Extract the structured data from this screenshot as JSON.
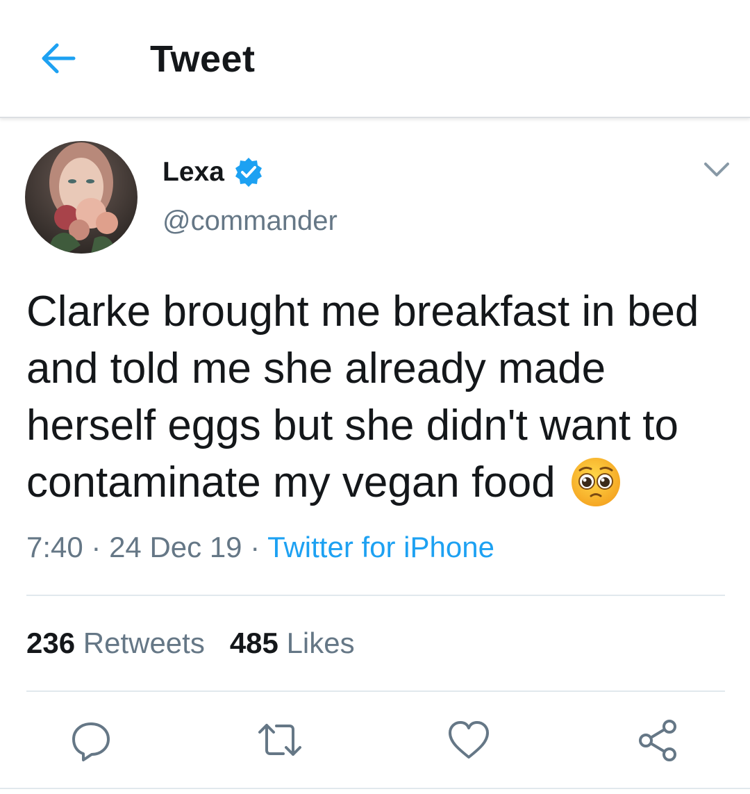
{
  "header": {
    "title": "Tweet",
    "back_icon": "arrow-left-icon",
    "accent": "#1da1f2"
  },
  "tweet": {
    "author": {
      "name": "Lexa",
      "handle": "@commander",
      "verified": true,
      "avatar_icon": "avatar-photo"
    },
    "text": "Clarke brought me breakfast in bed and told me she already made herself eggs but she didn't want to contaminate my vegan food",
    "emoji": "pleading-face-emoji",
    "time": "7:40",
    "separator": " · ",
    "date": "24 Dec 19",
    "source": "Twitter for iPhone",
    "retweets": {
      "count": "236",
      "label": "Retweets"
    },
    "likes": {
      "count": "485",
      "label": "Likes"
    }
  },
  "actions": [
    "reply-icon",
    "retweet-icon",
    "like-icon",
    "share-icon"
  ],
  "colors": {
    "text": "#14171a",
    "secondary": "#657786",
    "link": "#1da1f2",
    "divider": "#e1e8ed"
  }
}
